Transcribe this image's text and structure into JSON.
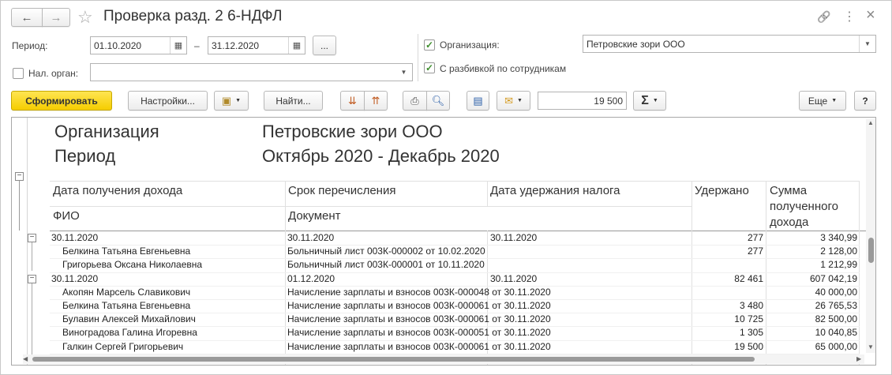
{
  "title": "Проверка разд. 2 6-НДФЛ",
  "nav": {
    "back_icon": "←",
    "forward_icon": "→",
    "star_icon": "☆"
  },
  "window_icons": {
    "link": "🔗",
    "more": "⋮",
    "close": "×"
  },
  "filters": {
    "period_label": "Период:",
    "date_from": "01.10.2020",
    "dash": "–",
    "date_to": "31.12.2020",
    "ellipsis": "...",
    "tax_label": "Нал. орган:",
    "tax_value": "",
    "org_label": "Организация:",
    "org_value": "Петровские зори ООО",
    "split_label": "С разбивкой по сотрудникам",
    "org_checked": true,
    "split_checked": true,
    "tax_checked": false
  },
  "toolbar": {
    "generate": "Сформировать",
    "settings": "Настройки...",
    "find": "Найти...",
    "sum_value": "19 500",
    "sigma": "Σ",
    "more": "Еще",
    "help": "?"
  },
  "report": {
    "org_label": "Организация",
    "org_value": "Петровские зори ООО",
    "period_label": "Период",
    "period_value": "Октябрь 2020 - Декабрь 2020",
    "col_date_income": "Дата получения дохода",
    "col_fio": "ФИО",
    "col_deadline": "Срок перечисления",
    "col_document": "Документ",
    "col_date_withheld": "Дата удержания налога",
    "col_withheld": "Удержано",
    "col_income_l1": "Сумма",
    "col_income_l2": "полученного",
    "col_income_l3": "дохода",
    "rows": [
      {
        "kind": "group",
        "c1": "30.11.2020",
        "c2": "30.11.2020",
        "c3": "30.11.2020",
        "c4": "277",
        "c5": "3 340,99"
      },
      {
        "kind": "item",
        "c1": "Белкина Татьяна Евгеньевна",
        "c2": "Больничный лист 003К-000002 от 10.02.2020",
        "c3": "",
        "c4": "277",
        "c5": "2 128,00"
      },
      {
        "kind": "item",
        "c1": "Григорьева Оксана Николаевна",
        "c2": "Больничный лист 003К-000001 от 10.11.2020",
        "c3": "",
        "c4": "",
        "c5": "1 212,99"
      },
      {
        "kind": "group",
        "c1": "30.11.2020",
        "c2": "01.12.2020",
        "c3": "30.11.2020",
        "c4": "82 461",
        "c5": "607 042,19"
      },
      {
        "kind": "item",
        "c1": "Акопян Марсель Славикович",
        "c2": "Начисление зарплаты и взносов 003К-000048 от 30.11.2020",
        "c3": "",
        "c4": "",
        "c5": "40 000,00"
      },
      {
        "kind": "item",
        "c1": "Белкина Татьяна Евгеньевна",
        "c2": "Начисление зарплаты и взносов 003К-000061 от 30.11.2020",
        "c3": "",
        "c4": "3 480",
        "c5": "26 765,53"
      },
      {
        "kind": "item",
        "c1": "Булавин Алексей Михайлович",
        "c2": "Начисление зарплаты и взносов 003К-000061 от 30.11.2020",
        "c3": "",
        "c4": "10 725",
        "c5": "82 500,00"
      },
      {
        "kind": "item",
        "c1": "Виноградова Галина Игоревна",
        "c2": "Начисление зарплаты и взносов 003К-000051 от 30.11.2020",
        "c3": "",
        "c4": "1 305",
        "c5": "10 040,85"
      },
      {
        "kind": "item",
        "c1": "Галкин Сергей Григорьевич",
        "c2": "Начисление зарплаты и взносов 003К-000061 от 30.11.2020",
        "c3": "",
        "c4": "19 500",
        "c5": "65 000,00"
      }
    ]
  },
  "colors": {
    "accent_yellow": "#f5cd00",
    "check_green": "#3f8f2e"
  }
}
